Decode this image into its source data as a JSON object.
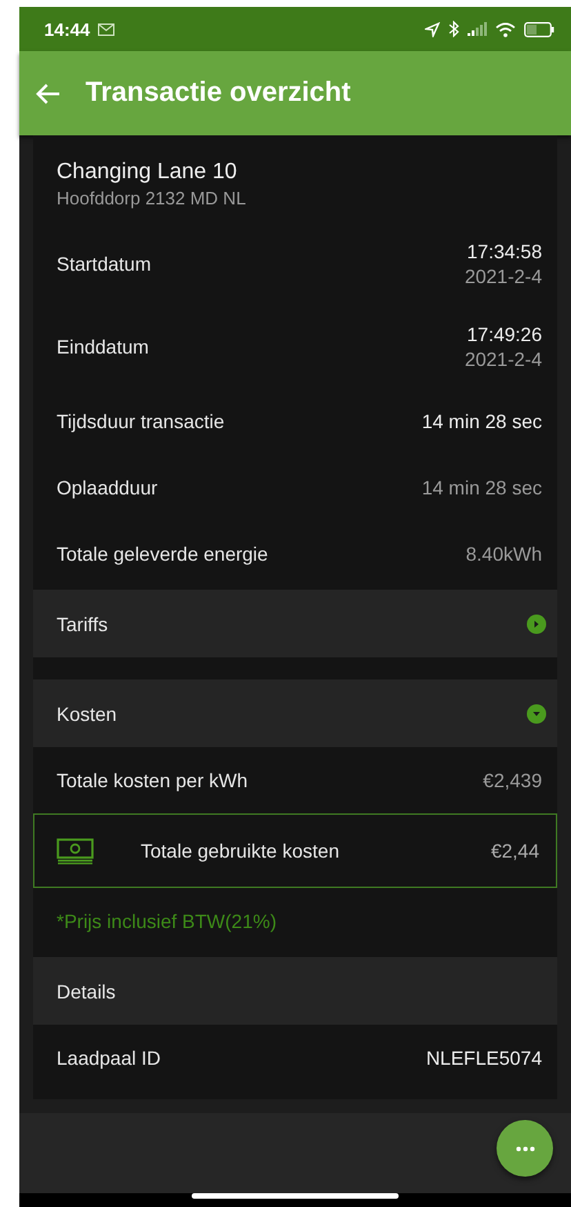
{
  "status_bar": {
    "time": "14:44"
  },
  "app_bar": {
    "title": "Transactie overzicht"
  },
  "location": {
    "name": "Changing Lane 10",
    "address": "Hoofddorp 2132 MD NL"
  },
  "items": [
    {
      "kind": "row",
      "label": "Startdatum",
      "value": "17:34:58",
      "sub_value": "2021-2-4",
      "highlight": true
    },
    {
      "kind": "row",
      "label": "Einddatum",
      "value": "17:49:26",
      "sub_value": "2021-2-4",
      "highlight": true
    },
    {
      "kind": "row",
      "label": "Tijdsduur transactie",
      "value": "14 min 28 sec",
      "highlight": true
    },
    {
      "kind": "row",
      "label": "Oplaadduur",
      "value": "14 min 28 sec",
      "highlight": false
    },
    {
      "kind": "row",
      "label": "Totale geleverde energie",
      "value": "8.40kWh",
      "highlight": false
    },
    {
      "kind": "section",
      "label": "Tariffs",
      "expanded": false
    },
    {
      "kind": "section",
      "label": "Kosten",
      "expanded": true
    },
    {
      "kind": "row",
      "label": "Totale kosten per kWh",
      "value": "€2,439",
      "highlight": false
    },
    {
      "kind": "total",
      "label": "Totale gebruikte kosten",
      "value": "€2,44"
    },
    {
      "kind": "note",
      "label": "*Prijs inclusief BTW(21%)"
    },
    {
      "kind": "section",
      "label": "Details"
    },
    {
      "kind": "row",
      "label": "Laadpaal ID",
      "value": "NLEFLE5074",
      "highlight": true
    }
  ]
}
